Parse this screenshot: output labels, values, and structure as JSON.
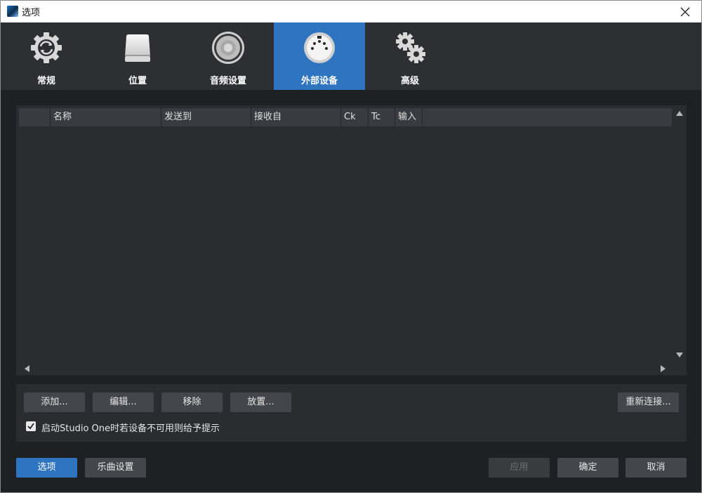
{
  "window": {
    "title": "选项"
  },
  "tabs": [
    {
      "label": "常规",
      "icon": "gear-sync-icon",
      "active": false
    },
    {
      "label": "位置",
      "icon": "drive-icon",
      "active": false
    },
    {
      "label": "音频设置",
      "icon": "speaker-icon",
      "active": false
    },
    {
      "label": "外部设备",
      "icon": "midi-connector-icon",
      "active": true
    },
    {
      "label": "高级",
      "icon": "gears-icon",
      "active": false
    }
  ],
  "device_list": {
    "columns": [
      "",
      "名称",
      "发送到",
      "接收自",
      "Ck",
      "Tc",
      "输入",
      ""
    ],
    "rows": []
  },
  "actions": {
    "add": "添加...",
    "edit": "编辑...",
    "remove": "移除",
    "place": "放置...",
    "reconnect": "重新连接...",
    "notify_checkbox": {
      "label": "启动Studio One时若设备不可用则给予提示",
      "checked": true
    }
  },
  "footer": {
    "options": "选项",
    "song_settings": "乐曲设置",
    "apply": "应用",
    "ok": "确定",
    "cancel": "取消"
  },
  "colors": {
    "accent": "#2f74c0",
    "background": "#1f2023",
    "panel": "#2b2c30"
  }
}
